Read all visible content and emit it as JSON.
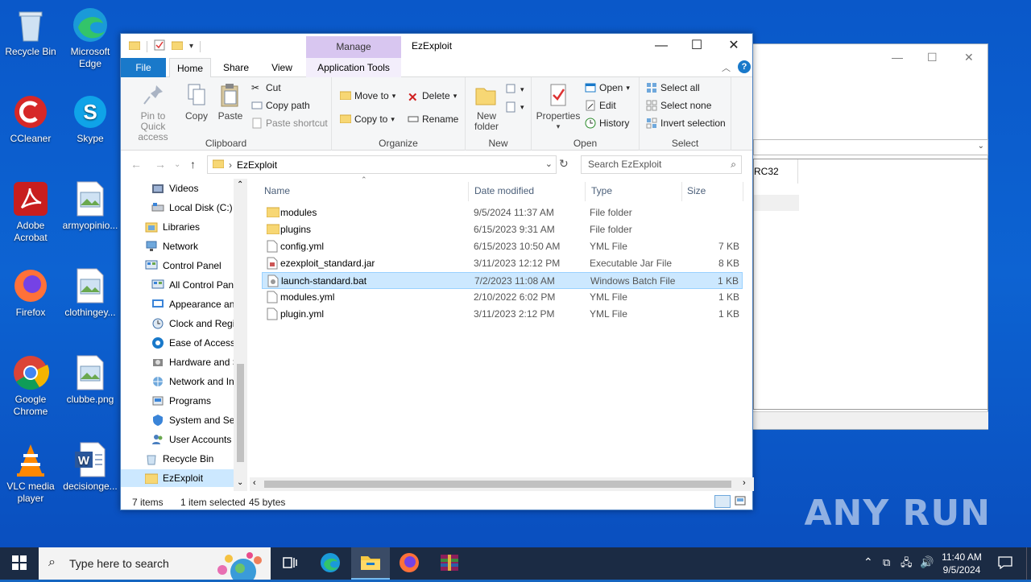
{
  "desktop": {
    "icons": [
      {
        "label": "Recycle Bin",
        "icon": "recycle-bin-icon"
      },
      {
        "label": "Microsoft Edge",
        "icon": "edge-icon"
      },
      {
        "label": "CCleaner",
        "icon": "ccleaner-icon"
      },
      {
        "label": "Skype",
        "icon": "skype-icon"
      },
      {
        "label": "Adobe Acrobat",
        "icon": "acrobat-icon"
      },
      {
        "label": "armyopinio...",
        "icon": "image-file-icon"
      },
      {
        "label": "Firefox",
        "icon": "firefox-icon"
      },
      {
        "label": "clothingey...",
        "icon": "image-file-icon"
      },
      {
        "label": "Google Chrome",
        "icon": "chrome-icon"
      },
      {
        "label": "clubbe.png",
        "icon": "image-file-icon"
      },
      {
        "label": "VLC media player",
        "icon": "vlc-icon"
      },
      {
        "label": "decisionge...",
        "icon": "word-file-icon"
      }
    ],
    "watermark": "ANY RUN",
    "bg_window_text": "RC32"
  },
  "explorer": {
    "title": "EzExploit",
    "manage_label": "Manage",
    "tabs": {
      "file": "File",
      "home": "Home",
      "share": "Share",
      "view": "View",
      "application_tools": "Application Tools"
    },
    "ribbon": {
      "clipboard": {
        "pin": "Pin to Quick access",
        "copy": "Copy",
        "paste": "Paste",
        "cut": "Cut",
        "copy_path": "Copy path",
        "paste_shortcut": "Paste shortcut",
        "label": "Clipboard"
      },
      "organize": {
        "move_to": "Move to",
        "copy_to": "Copy to",
        "delete": "Delete",
        "rename": "Rename",
        "label": "Organize"
      },
      "new": {
        "new_folder": "New folder",
        "label": "New"
      },
      "open": {
        "properties": "Properties",
        "open": "Open",
        "edit": "Edit",
        "history": "History",
        "label": "Open"
      },
      "select": {
        "select_all": "Select all",
        "select_none": "Select none",
        "invert_selection": "Invert selection",
        "label": "Select"
      }
    },
    "address": {
      "path": "EzExploit",
      "search_placeholder": "Search EzExploit"
    },
    "nav_items": [
      {
        "label": "Videos",
        "indent": 1,
        "icon": "videos-folder-icon"
      },
      {
        "label": "Local Disk (C:)",
        "indent": 1,
        "icon": "drive-icon"
      },
      {
        "label": "Libraries",
        "indent": 0,
        "icon": "libraries-icon"
      },
      {
        "label": "Network",
        "indent": 0,
        "icon": "network-icon"
      },
      {
        "label": "Control Panel",
        "indent": 0,
        "icon": "control-panel-icon"
      },
      {
        "label": "All Control Panel Items",
        "indent": 1,
        "icon": "control-panel-icon"
      },
      {
        "label": "Appearance and Personalization",
        "indent": 1,
        "icon": "appearance-icon"
      },
      {
        "label": "Clock and Region",
        "indent": 1,
        "icon": "clock-icon"
      },
      {
        "label": "Ease of Access",
        "indent": 1,
        "icon": "ease-access-icon"
      },
      {
        "label": "Hardware and Sound",
        "indent": 1,
        "icon": "hardware-icon"
      },
      {
        "label": "Network and Internet",
        "indent": 1,
        "icon": "network-internet-icon"
      },
      {
        "label": "Programs",
        "indent": 1,
        "icon": "programs-icon"
      },
      {
        "label": "System and Security",
        "indent": 1,
        "icon": "security-icon"
      },
      {
        "label": "User Accounts",
        "indent": 1,
        "icon": "user-accounts-icon"
      },
      {
        "label": "Recycle Bin",
        "indent": 0,
        "icon": "recycle-bin-icon"
      },
      {
        "label": "EzExploit",
        "indent": 0,
        "icon": "folder-icon",
        "selected": true
      }
    ],
    "columns": {
      "name": "Name",
      "date": "Date modified",
      "type": "Type",
      "size": "Size"
    },
    "files": [
      {
        "name": "modules",
        "date": "9/5/2024 11:37 AM",
        "type": "File folder",
        "size": "",
        "icon": "folder-icon"
      },
      {
        "name": "plugins",
        "date": "6/15/2023 9:31 AM",
        "type": "File folder",
        "size": "",
        "icon": "folder-icon"
      },
      {
        "name": "config.yml",
        "date": "6/15/2023 10:50 AM",
        "type": "YML File",
        "size": "7 KB",
        "icon": "file-icon"
      },
      {
        "name": "ezexploit_standard.jar",
        "date": "3/11/2023 12:12 PM",
        "type": "Executable Jar File",
        "size": "8 KB",
        "icon": "jar-icon"
      },
      {
        "name": "launch-standard.bat",
        "date": "7/2/2023 11:08 AM",
        "type": "Windows Batch File",
        "size": "1 KB",
        "icon": "batch-file-icon",
        "selected": true
      },
      {
        "name": "modules.yml",
        "date": "2/10/2022 6:02 PM",
        "type": "YML File",
        "size": "1 KB",
        "icon": "file-icon"
      },
      {
        "name": "plugin.yml",
        "date": "3/11/2023 2:12 PM",
        "type": "YML File",
        "size": "1 KB",
        "icon": "file-icon"
      }
    ],
    "status": {
      "count": "7 items",
      "selection": "1 item selected",
      "bytes": "45 bytes"
    }
  },
  "taskbar": {
    "search_placeholder": "Type here to search",
    "time": "11:40 AM",
    "date": "9/5/2024"
  }
}
